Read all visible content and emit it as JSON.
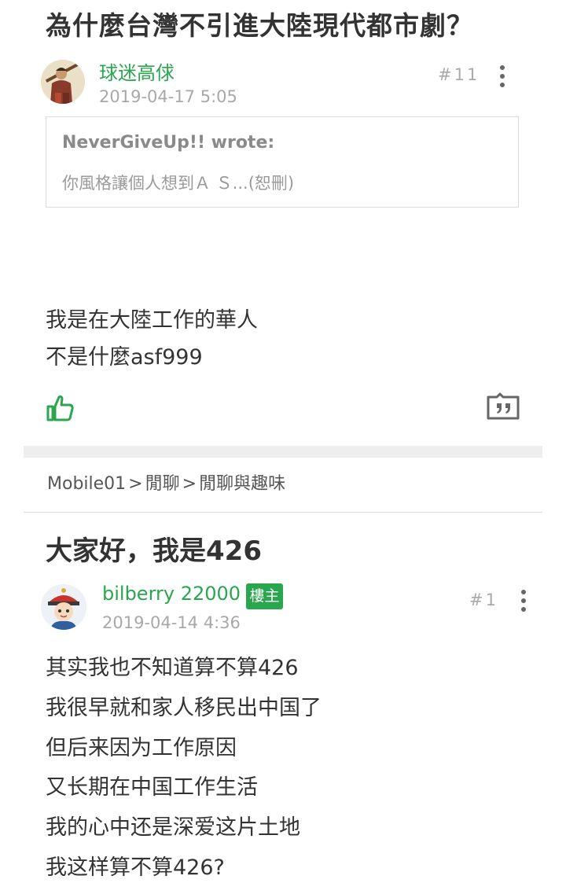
{
  "thread_top": {
    "title": "為什麼台灣不引進大陸現代都市劇？",
    "post": {
      "username": "球迷高俅",
      "date": "2019-04-17 5:05",
      "floor": "#11",
      "quote": {
        "author": "NeverGiveUp!! wrote:",
        "text": "你風格讓個人想到Ａ Ｓ...(恕刪)"
      },
      "lines": [
        "我是在大陸工作的華人",
        "不是什麼asf999"
      ]
    }
  },
  "breadcrumb": {
    "items": [
      "Mobile01",
      "閒聊",
      "閒聊與趣味"
    ],
    "separator": ">"
  },
  "thread_second": {
    "title": "大家好，我是426",
    "post": {
      "username": "bilberry 22000",
      "badge": "樓主",
      "date": "2019-04-14 4:36",
      "floor": "#1",
      "lines": [
        "其实我也不知道算不算426",
        "我很早就和家人移民出中国了",
        "但后来因为工作原因",
        "又长期在中国工作生活",
        "我的心中还是深爱这片土地",
        "我这样算不算426?"
      ]
    }
  },
  "icons": {
    "like": "thumbs-up-icon",
    "reply": "quote-reply-icon",
    "more": "more-vertical-icon"
  },
  "colors": {
    "accent_green": "#2aa64f",
    "text_dark": "#333333",
    "muted": "#a8a8a8",
    "divider": "#eeeeee"
  }
}
